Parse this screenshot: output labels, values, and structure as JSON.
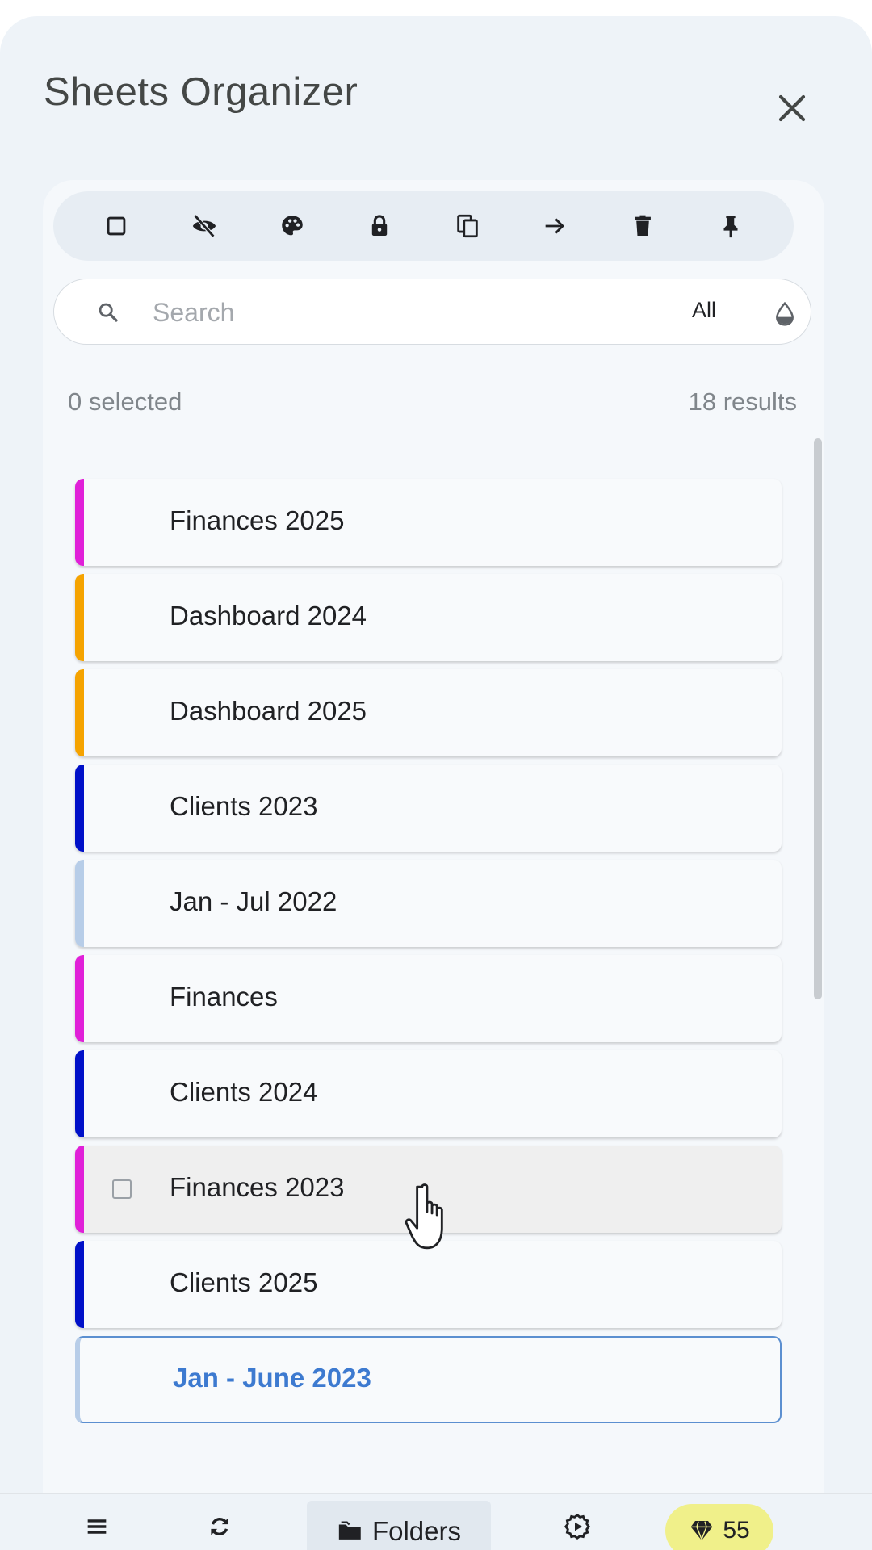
{
  "header": {
    "title": "Sheets Organizer"
  },
  "toolbar": {
    "tools": [
      "select-all",
      "hide",
      "color",
      "lock",
      "copy",
      "move",
      "delete",
      "pin"
    ]
  },
  "search": {
    "placeholder": "Search",
    "value": "",
    "filter": "All"
  },
  "counts": {
    "selected": "0 selected",
    "results": "18 results"
  },
  "sheets": [
    {
      "name": "Finances 2025",
      "color": "#e020d8"
    },
    {
      "name": "Dashboard 2024",
      "color": "#f5a300"
    },
    {
      "name": "Dashboard 2025",
      "color": "#f5a300"
    },
    {
      "name": "Clients 2023",
      "color": "#0010c8"
    },
    {
      "name": "Jan - Jul 2022",
      "color": "#b7cde8"
    },
    {
      "name": "Finances",
      "color": "#e020d8"
    },
    {
      "name": "Clients 2024",
      "color": "#0010c8"
    },
    {
      "name": "Finances 2023",
      "color": "#e020d8",
      "state": "hover"
    },
    {
      "name": "Clients 2025",
      "color": "#0010c8"
    },
    {
      "name": "Jan - June 2023",
      "color": "#b7cde8",
      "state": "active"
    }
  ],
  "bottom_nav": {
    "menu_icon": "menu-icon",
    "refresh_icon": "refresh-icon",
    "folders_label": "Folders",
    "settings_icon": "settings-icon",
    "gems_count": "55"
  },
  "colors": {
    "accent": "#3d7ad0",
    "badge": "#f0f08a"
  }
}
